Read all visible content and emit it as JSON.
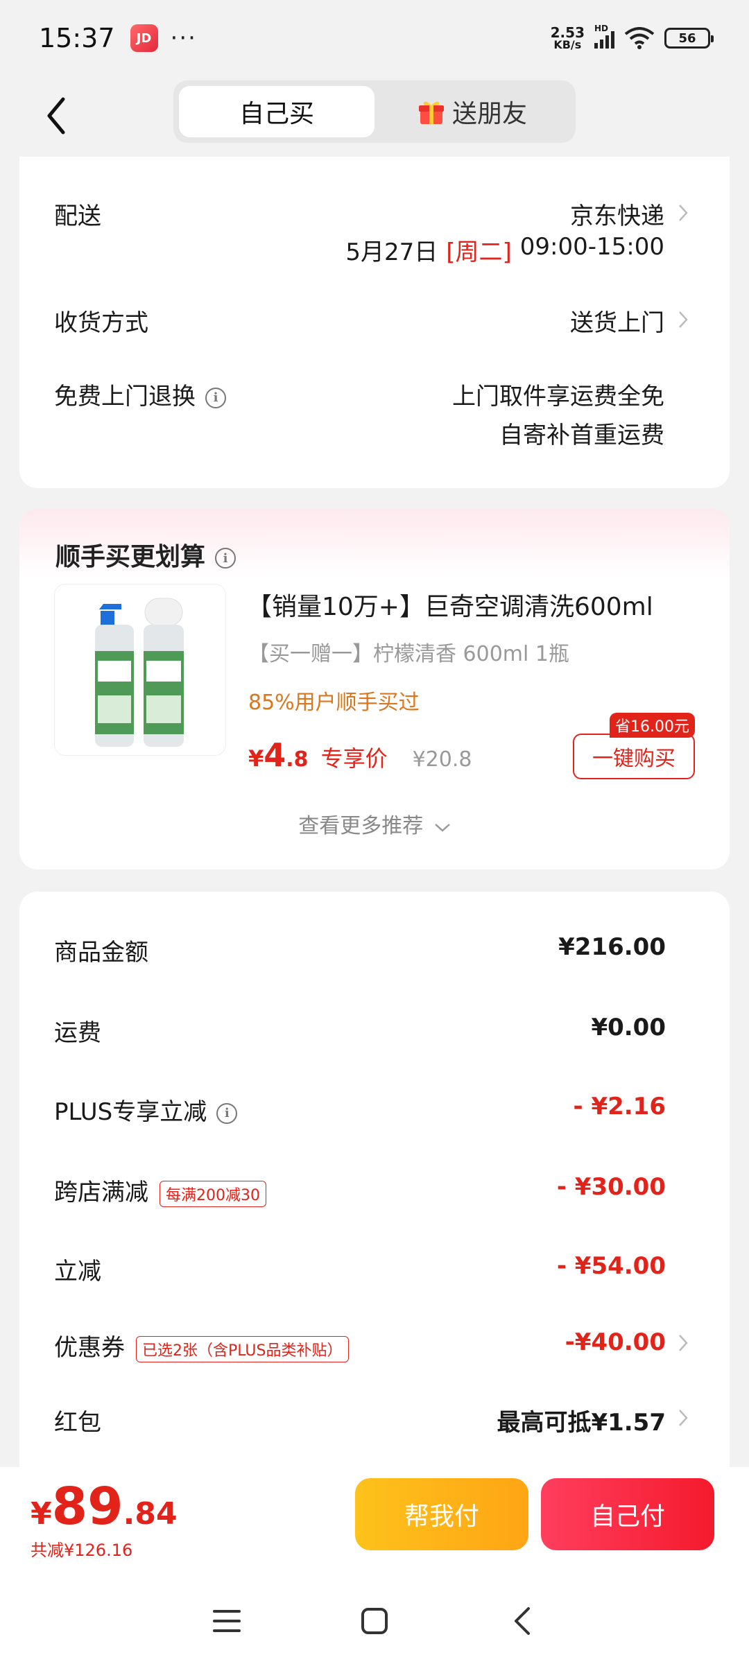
{
  "status_bar": {
    "time": "15:37",
    "app_icon_text": "JD",
    "dots": "···",
    "net_speed": "2.53",
    "net_unit": "KB/s",
    "signal_hd": "HD",
    "battery": "56"
  },
  "header": {
    "tab_self": "自己买",
    "tab_gift": "送朋友"
  },
  "delivery": {
    "shipping_label": "配送",
    "shipping_value": "京东快递",
    "shipping_date": "5月27日",
    "shipping_weekday": "[周二]",
    "shipping_time": "09:00-15:00",
    "receive_label": "收货方式",
    "receive_value": "送货上门",
    "return_label": "免费上门退换",
    "return_line1": "上门取件享运费全免",
    "return_line2": "自寄补首重运费"
  },
  "recommend": {
    "title": "顺手买更划算",
    "product_name": "【销量10万+】巨奇空调清洗600ml",
    "product_spec": "【买一赠一】柠檬清香 600ml 1瓶",
    "social_proof": "85%用户顺手买过",
    "price_symbol": "¥",
    "price_int": "4",
    "price_dec": ".8",
    "price_tag": "专享价",
    "original_price": "¥20.8",
    "save_badge": "省16.00元",
    "buy_button": "一键购买",
    "more": "查看更多推荐"
  },
  "summary": {
    "goods_label": "商品金额",
    "goods_value": "¥216.00",
    "freight_label": "运费",
    "freight_value": "¥0.00",
    "plus_label": "PLUS专享立减",
    "plus_value": "- ¥2.16",
    "cross_label": "跨店满减",
    "cross_tag": "每满200减30",
    "cross_value": "- ¥30.00",
    "instant_label": "立减",
    "instant_value": "- ¥54.00",
    "coupon_label": "优惠券",
    "coupon_tag": "已选2张（含PLUS品类补贴）",
    "coupon_value": "-¥40.00",
    "redpacket_label": "红包",
    "redpacket_value": "最高可抵¥1.57"
  },
  "bottom": {
    "total_symbol": "¥",
    "total_int": "89",
    "total_dec": ".84",
    "total_saved": "共减¥126.16",
    "friend_pay": "帮我付",
    "self_pay": "自己付"
  },
  "colors": {
    "accent_red": "#e2231a",
    "orange": "#d9771e",
    "friend_yellow": "#fdc21b",
    "self_red": "#f41a2c"
  }
}
